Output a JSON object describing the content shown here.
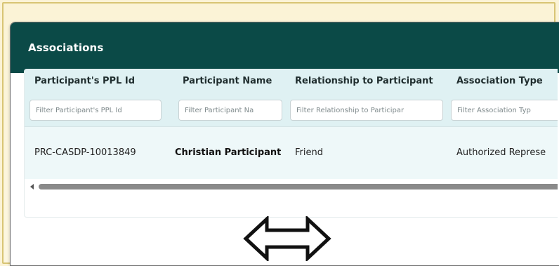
{
  "panel": {
    "title": "Associations"
  },
  "table": {
    "columns": [
      {
        "header": "Participant's PPL Id",
        "filter_placeholder": "Filter Participant's PPL Id"
      },
      {
        "header": "Participant Name",
        "filter_placeholder": "Filter Participant Na"
      },
      {
        "header": "Relationship to Participant",
        "filter_placeholder": "Filter Relationship to Participar"
      },
      {
        "header": "Association Type",
        "filter_placeholder": "Filter Association Typ"
      }
    ],
    "rows": [
      {
        "ppl_id": "PRC-CASDP-10013849",
        "name": "Christian Participant",
        "relationship": "Friend",
        "association_type": "Authorized Represe"
      }
    ]
  },
  "icons": {
    "scroll_left": "scroll-left-arrow-icon",
    "resize": "double-arrow-horizontal-icon"
  },
  "colors": {
    "header_bg": "#0b4a47",
    "grid_header_bg": "#dff1f3",
    "row_bg": "#eef8f9",
    "page_bg": "#fbf3d6"
  }
}
